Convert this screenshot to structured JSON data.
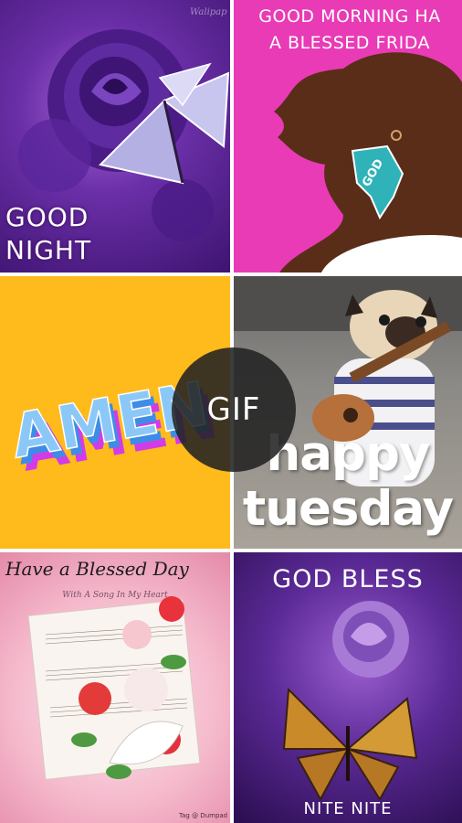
{
  "feed": {
    "tiles": [
      {
        "caption": "GOOD NIGHT",
        "line1": "GOOD",
        "line2": "NIGHT",
        "watermark": "Walipap"
      },
      {
        "caption": "GOOD MORNING HAVE A BLESSED FRIDAY",
        "line1": "GOOD MORNING HA",
        "line2": "A BLESSED FRIDA",
        "earring_text": "GOD"
      },
      {
        "caption": "AMEN",
        "word": "AMEN"
      },
      {
        "caption": "happy tuesday",
        "line1": "happy",
        "line2": "tuesday"
      },
      {
        "caption": "Have a Blessed Day",
        "title": "Have a Blessed Day",
        "subtitle": "With A Song In My Heart",
        "tag": "Tag @ Dumpad"
      },
      {
        "caption": "GOD BLESS NITE NITE",
        "line1": "GOD BLESS",
        "line2": "NITE NITE"
      }
    ]
  },
  "overlay": {
    "gif_badge": "GIF"
  },
  "colors": {
    "purple": "#6b2fa8",
    "magenta": "#e93bb6",
    "yellow": "#ffba1c",
    "pink": "#f5b9cc",
    "deep_purple": "#2a0d4f",
    "badge": "#222222"
  },
  "icons": [
    "rose-icon",
    "butterfly-icon",
    "silhouette-icon",
    "pug-icon",
    "guitar-icon",
    "flowers-icon"
  ]
}
